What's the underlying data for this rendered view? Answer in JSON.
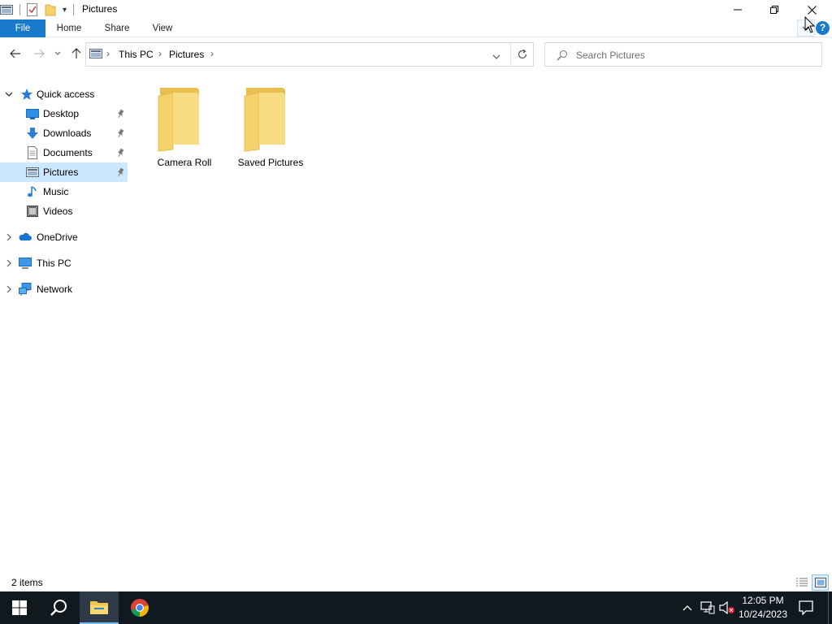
{
  "window": {
    "title": "Pictures",
    "qat_dropdown_glyph": "▾"
  },
  "ribbon": {
    "tabs": [
      {
        "label": "File"
      },
      {
        "label": "Home"
      },
      {
        "label": "Share"
      },
      {
        "label": "View"
      }
    ]
  },
  "address": {
    "segments": [
      "This PC",
      "Pictures"
    ],
    "separator": "›"
  },
  "search": {
    "placeholder": "Search Pictures"
  },
  "nav": {
    "quick_access": "Quick access",
    "pinned": [
      {
        "label": "Desktop",
        "icon": "desktop-icon",
        "pinned": true
      },
      {
        "label": "Downloads",
        "icon": "downloads-icon",
        "pinned": true
      },
      {
        "label": "Documents",
        "icon": "documents-icon",
        "pinned": true
      },
      {
        "label": "Pictures",
        "icon": "pictures-icon",
        "pinned": true,
        "selected": true
      },
      {
        "label": "Music",
        "icon": "music-icon",
        "pinned": false
      },
      {
        "label": "Videos",
        "icon": "videos-icon",
        "pinned": false
      }
    ],
    "onedrive": "OneDrive",
    "this_pc": "This PC",
    "network": "Network"
  },
  "content": {
    "folders": [
      {
        "name": "Camera Roll"
      },
      {
        "name": "Saved Pictures"
      }
    ]
  },
  "status": {
    "item_count": "2 items"
  },
  "taskbar": {
    "time": "12:05 PM",
    "date": "10/24/2023"
  },
  "colors": {
    "accent": "#1979ca",
    "selection": "#cce8ff",
    "taskbar": "#101820",
    "folder": "#f5d16b"
  }
}
